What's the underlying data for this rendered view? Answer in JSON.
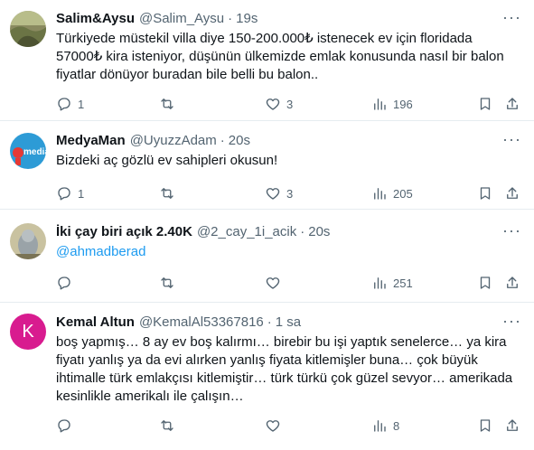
{
  "tweets": [
    {
      "name": "Salim&Aysu",
      "handle": "@Salim_Aysu",
      "time": "19s",
      "text": "Türkiyede müstekil villa diye 150-200.000₺ istenecek ev için floridada 57000₺ kira isteniyor, düşünün ülkemizde emlak konusunda nasıl bir balon fiyatlar dönüyor buradan bile belli bu balon..",
      "replies": "1",
      "retweets": "",
      "likes": "3",
      "views": "196"
    },
    {
      "name": "MedyaMan",
      "handle": "@UyuzzAdam",
      "time": "20s",
      "text": "Bizdeki aç gözlü ev sahipleri okusun!",
      "avatar_text": "media",
      "replies": "1",
      "retweets": "",
      "likes": "3",
      "views": "205"
    },
    {
      "name": "İki çay biri açık 2.40K",
      "handle": "@2_cay_1i_acik",
      "time": "20s",
      "text": "@ahmadberad",
      "replies": "",
      "retweets": "",
      "likes": "",
      "views": "251"
    },
    {
      "name": "Kemal Altun",
      "handle": "@KemalAl53367816",
      "time": "1 sa",
      "avatar_letter": "K",
      "text": "boş yapmış… 8 ay ev boş kalırmı… birebir bu işi yaptık senelerce… ya kira fiyatı yanlış ya da evi alırken yanlış fiyata kitlemişler buna… çok büyük ihtimalle türk emlakçısı kitlemiştir… türk türkü çok güzel sevyor… amerikada kesinlikle amerikalı ile çalışın…",
      "replies": "",
      "retweets": "",
      "likes": "",
      "views": "8"
    }
  ],
  "more_glyph": "···",
  "separator": "·",
  "colors": {
    "text": "#0f1419",
    "secondary": "#536471",
    "link": "#1d9bf0",
    "divider": "#e6ecf0",
    "kemal_avatar": "#d81b8f"
  },
  "icons": [
    "reply-icon",
    "retweet-icon",
    "like-icon",
    "views-icon",
    "bookmark-icon",
    "share-icon",
    "more-icon"
  ]
}
